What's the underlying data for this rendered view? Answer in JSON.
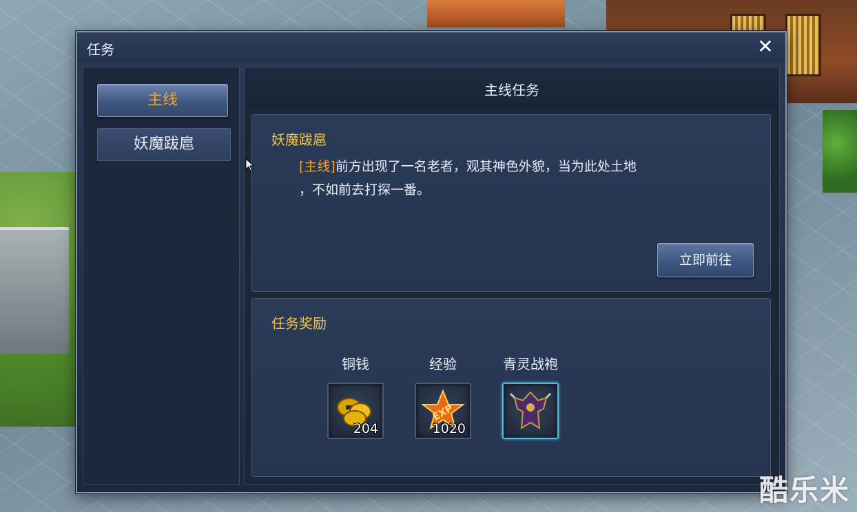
{
  "window": {
    "title": "任务",
    "close_icon": "close-icon"
  },
  "sidebar": {
    "tabs": [
      {
        "label": "主线",
        "active": true
      },
      {
        "label": "妖魔跋扈",
        "active": false
      }
    ]
  },
  "main": {
    "header": "主线任务",
    "quest": {
      "name": "妖魔跋扈",
      "tag": "[主线]",
      "line1": "前方出现了一名老者，观其神色外貌，当为此处土地",
      "line2": "，不如前去打探一番。",
      "go_button": "立即前往"
    },
    "rewards": {
      "title": "任务奖励",
      "items": [
        {
          "label": "铜钱",
          "icon": "coins-icon",
          "qty": "204"
        },
        {
          "label": "经验",
          "icon": "exp-star-icon",
          "qty": "1020"
        },
        {
          "label": "青灵战袍",
          "icon": "armor-robe-icon",
          "qty": ""
        }
      ]
    }
  },
  "watermark": "酷乐米",
  "colors": {
    "accent_orange": "#f5a02a",
    "title_gold": "#f2c24a",
    "panel_bg": "#2a3b58"
  }
}
